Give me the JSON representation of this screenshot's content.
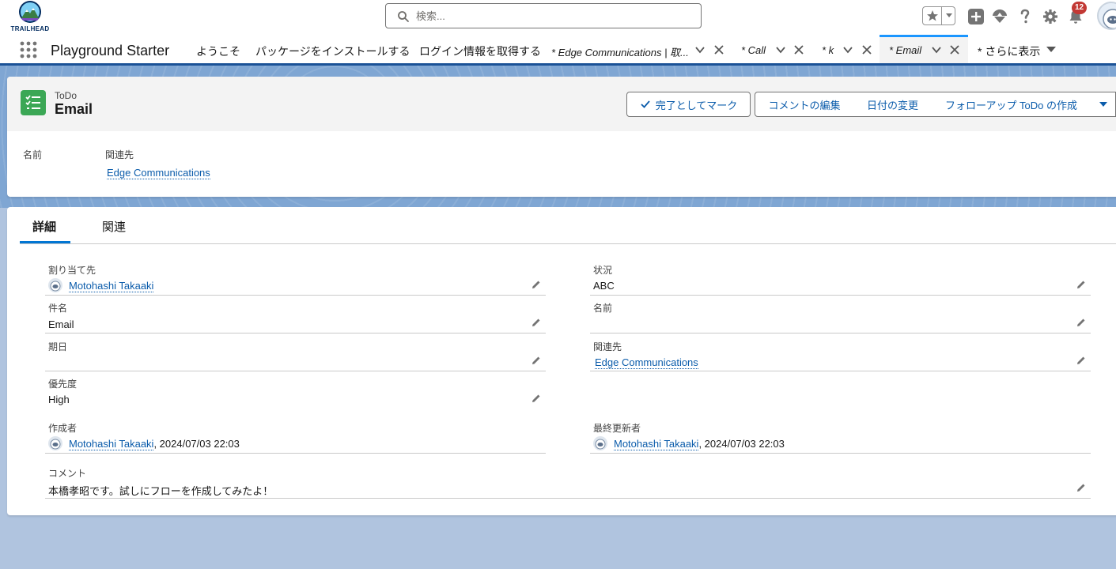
{
  "branding": {
    "logo_text": "TRAILHEAD"
  },
  "search": {
    "placeholder": "検索..."
  },
  "notifications": {
    "count": "12"
  },
  "nav": {
    "app_name": "Playground Starter",
    "items": [
      "ようこそ",
      "パッケージをインストールする",
      "ログイン情報を取得する"
    ],
    "tabs": [
      {
        "label": "* Edge Communications | 取...",
        "active": false
      },
      {
        "label": "* Call",
        "active": false
      },
      {
        "label": "* k",
        "active": false
      },
      {
        "label": "* Email",
        "active": true
      }
    ],
    "more_label": "* さらに表示"
  },
  "record": {
    "object_label": "ToDo",
    "title": "Email",
    "actions": [
      "完了としてマーク",
      "コメントの編集",
      "日付の変更",
      "フォローアップ ToDo の作成"
    ],
    "highlights": {
      "name_label": "名前",
      "related_label": "関連先",
      "related_value": "Edge Communications"
    }
  },
  "detail": {
    "tabs": [
      "詳細",
      "関連"
    ],
    "fields": {
      "assigned": {
        "label": "割り当て先",
        "value": "Motohashi Takaaki"
      },
      "status": {
        "label": "状況",
        "value": "ABC"
      },
      "subject": {
        "label": "件名",
        "value": "Email"
      },
      "name": {
        "label": "名前",
        "value": ""
      },
      "due": {
        "label": "期日",
        "value": ""
      },
      "related": {
        "label": "関連先",
        "value": "Edge Communications"
      },
      "priority": {
        "label": "優先度",
        "value": "High"
      },
      "created_by": {
        "label": "作成者",
        "user": "Motohashi Takaaki",
        "date": ", 2024/07/03 22:03"
      },
      "modified_by": {
        "label": "最終更新者",
        "user": "Motohashi Takaaki",
        "date": ", 2024/07/03 22:03"
      },
      "comment": {
        "label": "コメント",
        "value": "本橋孝昭です。試しにフローを作成してみたよ！"
      }
    }
  },
  "colors": {
    "brand_blue": "#0176d3",
    "link": "#0b5cab",
    "todo_green": "#3ba755",
    "badge_red": "#c23934"
  }
}
